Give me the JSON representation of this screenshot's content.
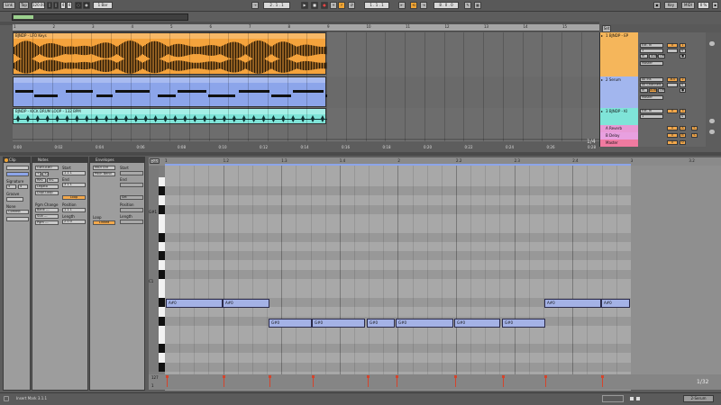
{
  "transport": {
    "link": "Link",
    "tap": "Tap",
    "tempo": "120.00",
    "signature_num": "4",
    "signature_den": "4",
    "quantize": "1 Bar",
    "position": "2 . 1 . 1",
    "loop_start": "1 . 1 . 1",
    "loop_length": "8 . 0 . 0",
    "key": "Key",
    "midi": "MIDI",
    "cpu": "0 %",
    "follow_icon": "follow-icon"
  },
  "arrangement": {
    "ruler": [
      "1",
      "2",
      "3",
      "4",
      "5",
      "6",
      "7",
      "8",
      "9",
      "10",
      "11",
      "12",
      "13",
      "14",
      "15"
    ],
    "times": [
      "0:00",
      "0:02",
      "0:04",
      "0:06",
      "0:08",
      "0:10",
      "0:12",
      "0:14",
      "0:16",
      "0:18",
      "0:20",
      "0:22",
      "0:24",
      "0:26",
      "0:28"
    ],
    "zoom": "1/4",
    "clips": [
      {
        "name": "BJNDP - LFO Keys",
        "color": "#f5a33c"
      },
      {
        "name": "",
        "color": "#8ca5ea"
      },
      {
        "name": "BJNDP - KICK DRUM LOOP - 132 BPM",
        "color": "#7fe4d8"
      }
    ],
    "tracks": [
      {
        "name": "1 BJNDP - EP",
        "color": "#f5b65b",
        "input": "Ext. In",
        "input2": "1",
        "monitor": "In",
        "auto": "Auto",
        "off": "Off",
        "out": "Master",
        "vol": "0",
        "num": "1",
        "solo": "S"
      },
      {
        "name": "2 Serum",
        "color": "#a2b6ee",
        "input": "All Ins",
        "input2": "All Channels",
        "monitor": "In",
        "auto": "Auto",
        "off": "Off",
        "out": "Master",
        "vol": "-6.0",
        "num": "2",
        "solo": "S"
      },
      {
        "name": "3 BJNDP - KI",
        "color": "#7fe4d8",
        "input": "Ext. In",
        "input2": "1",
        "monitor": "In",
        "auto": "Auto",
        "off": "Off",
        "out": "Master",
        "vol": "0",
        "num": "3",
        "solo": "S"
      },
      {
        "name": "A Reverb",
        "color": "#e89ad6",
        "vol": "0",
        "num": "A",
        "solo": "S"
      },
      {
        "name": "B Delay",
        "color": "#e8a0e0",
        "vol": "0",
        "num": "B",
        "solo": "S"
      },
      {
        "name": "Master",
        "color": "#f07aa0",
        "vol": "0",
        "num": "0"
      }
    ],
    "set_label": "Set"
  },
  "clip_panel": {
    "title": "Clip",
    "signature": "Signature",
    "sig_num": "4",
    "sig_den": "4",
    "groove": "Groove",
    "groove_val": "None",
    "commit": "Commit"
  },
  "notes_panel": {
    "title": "Notes",
    "range": "G#0-A#0",
    "rev": "Rev.",
    "inv": "Inv.",
    "legato": "Legato",
    "dupl": "Dupl.Loop",
    "start": "Start",
    "end": "End",
    "loop": "Loop",
    "position": "Position",
    "length": "Length",
    "pgm": "Pgm Change",
    "bank": "Bank ---",
    "sub": "Sub ---",
    "pgm_val": "Pgm ---",
    "start_val": "1 1 1",
    "end_val": "3 1 1",
    "pos_val": "1 1 1",
    "len_val": "2 0 0"
  },
  "env_panel": {
    "title": "Envelopes",
    "device": "MIDI Ctrl",
    "control": "Pitch Bend",
    "start": "Start",
    "end": "End",
    "position": "Position",
    "length": "Length",
    "loop": "Loop",
    "linked": "Linked",
    "set_label": "Set"
  },
  "editor": {
    "fold": "Fold",
    "ruler": [
      "1",
      "1.2",
      "1.3",
      "1.4",
      "2",
      "2.2",
      "2.3",
      "2.4",
      "3",
      "3.2"
    ],
    "octaves": [
      {
        "label": "G#1"
      },
      {
        "label": "C1"
      }
    ],
    "zoom": "1/32",
    "notes": [
      {
        "name": "A#0"
      },
      {
        "name": "A#0"
      },
      {
        "name": "G#0"
      },
      {
        "name": "G#0"
      },
      {
        "name": "G#0"
      },
      {
        "name": "G#0"
      },
      {
        "name": "G#0"
      },
      {
        "name": "G#0"
      },
      {
        "name": "A#0"
      },
      {
        "name": "A#0"
      }
    ],
    "vel_max": "127",
    "vel_min": "1"
  },
  "status": {
    "text": "Insert Mark 3.1.1",
    "track": "2-Serum"
  }
}
